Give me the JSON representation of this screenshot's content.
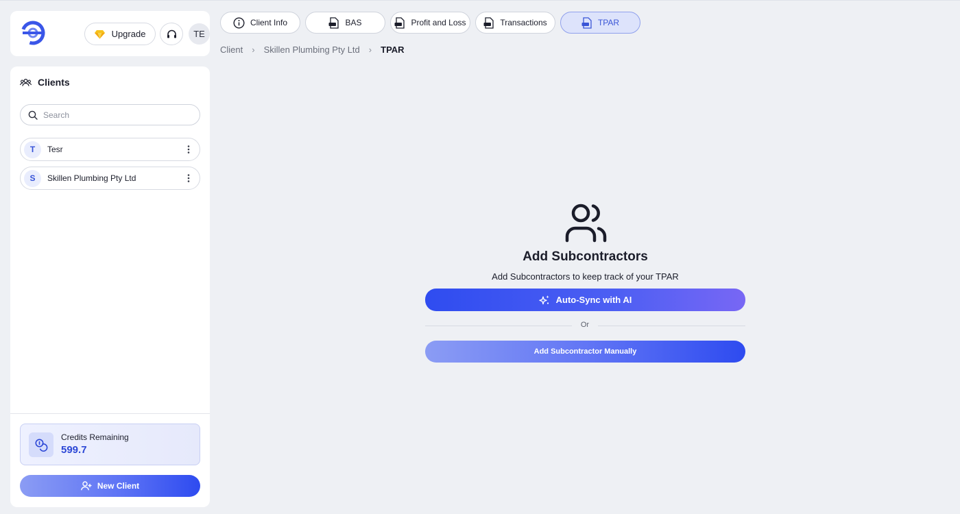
{
  "header": {
    "upgrade_label": "Upgrade",
    "avatar_initials": "TE"
  },
  "sidebar": {
    "title": "Clients",
    "search_placeholder": "Search",
    "clients": [
      {
        "initial": "T",
        "name": "Tesr"
      },
      {
        "initial": "S",
        "name": "Skillen Plumbing Pty Ltd"
      }
    ],
    "credits_label": "Credits Remaining",
    "credits_value": "599.7",
    "new_client_label": "New Client"
  },
  "tabs": [
    {
      "label": "Client Info",
      "icon": "info-icon"
    },
    {
      "label": "BAS",
      "icon": "pdf-file-icon"
    },
    {
      "label": "Profit and Loss",
      "icon": "pdf-file-icon"
    },
    {
      "label": "Transactions",
      "icon": "pdf-file-icon"
    },
    {
      "label": "TPAR",
      "icon": "pdf-file-icon",
      "active": true
    }
  ],
  "breadcrumb": {
    "items": [
      "Client",
      "Skillen Plumbing Pty Ltd"
    ],
    "current": "TPAR"
  },
  "empty_state": {
    "title": "Add Subcontractors",
    "subtitle": "Add Subcontractors to keep track of your TPAR",
    "autosync_label": "Auto-Sync with AI",
    "or_label": "Or",
    "manual_label": "Add Subcontractor Manually"
  },
  "colors": {
    "accent": "#2e4bf0",
    "background": "#eef0f4",
    "active_tab": "#dde3fb"
  }
}
